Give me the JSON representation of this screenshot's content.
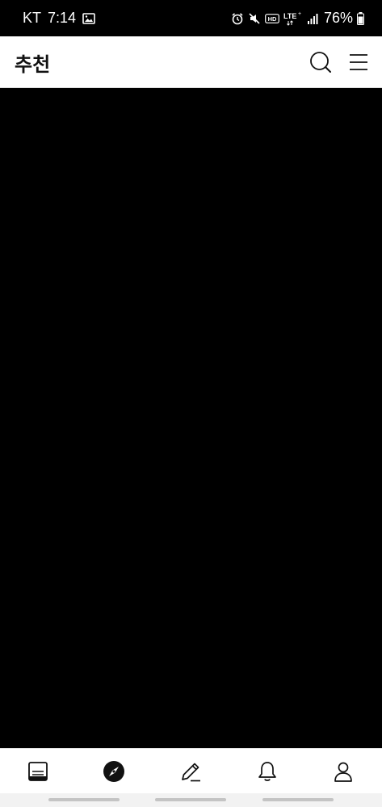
{
  "status_bar": {
    "carrier": "KT",
    "time": "7:14",
    "network": "LTE",
    "battery": "76%",
    "icons": [
      "image-icon",
      "alarm-icon",
      "mute-icon",
      "hd-icon",
      "lte-icon",
      "signal-icon",
      "battery-icon"
    ]
  },
  "header": {
    "title": "추천",
    "actions": [
      "search-icon",
      "menu-icon"
    ]
  },
  "bottom_nav": {
    "items": [
      {
        "icon": "feed-icon",
        "active": false
      },
      {
        "icon": "compass-icon",
        "active": true
      },
      {
        "icon": "pencil-icon",
        "active": false
      },
      {
        "icon": "bell-icon",
        "active": false
      },
      {
        "icon": "profile-icon",
        "active": false
      }
    ]
  },
  "colors": {
    "background": "#000000",
    "header": "#ffffff",
    "icon": "#111111"
  }
}
